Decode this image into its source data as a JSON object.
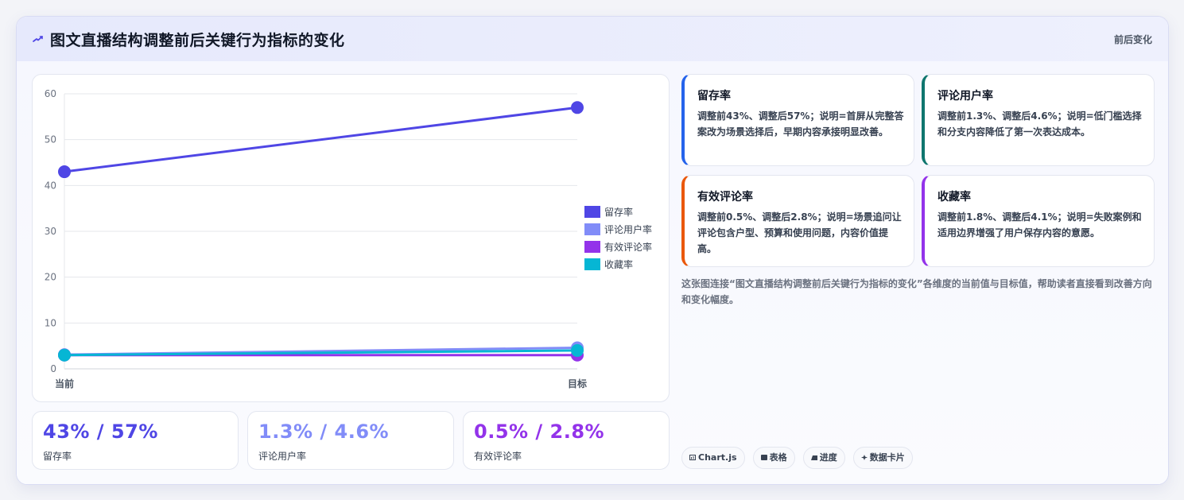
{
  "header": {
    "title": "图文直播结构调整前后关键行为指标的变化",
    "tag": "前后变化"
  },
  "colors": {
    "retention": "#4f46e5",
    "comment_users": "#818cf8",
    "valid_comment": "#9333ea",
    "favorite": "#06b6d4",
    "accent_blue": "#2563eb",
    "accent_teal": "#0f766e",
    "accent_orange": "#ea580c",
    "accent_purple": "#9333ea"
  },
  "chart_data": {
    "type": "line",
    "categories": [
      "当前",
      "目标"
    ],
    "series": [
      {
        "name": "留存率",
        "values": [
          43,
          57
        ],
        "color": "#4f46e5"
      },
      {
        "name": "评论用户率",
        "values": [
          3.1,
          4.6
        ],
        "color": "#818cf8"
      },
      {
        "name": "有效评论率",
        "values": [
          3.0,
          3.0
        ],
        "color": "#9333ea"
      },
      {
        "name": "收藏率",
        "values": [
          3.0,
          4.0
        ],
        "color": "#06b6d4"
      }
    ],
    "ylim": [
      0,
      60
    ],
    "yticks": [
      0,
      10,
      20,
      30,
      40,
      50,
      60
    ],
    "grid": true,
    "legend": "right"
  },
  "stats": [
    {
      "value": "43% / 57%",
      "label": "留存率",
      "color": "#4f46e5"
    },
    {
      "value": "1.3% / 4.6%",
      "label": "评论用户率",
      "color": "#818cf8"
    },
    {
      "value": "0.5% / 2.8%",
      "label": "有效评论率",
      "color": "#9333ea"
    }
  ],
  "metrics": [
    {
      "title": "留存率",
      "desc": "调整前43%、调整后57%；说明=首屏从完整答案改为场景选择后，早期内容承接明显改善。"
    },
    {
      "title": "评论用户率",
      "desc": "调整前1.3%、调整后4.6%；说明=低门槛选择和分支内容降低了第一次表达成本。"
    },
    {
      "title": "有效评论率",
      "desc": "调整前0.5%、调整后2.8%；说明=场景追问让评论包含户型、预算和使用问题，内容价值提高。"
    },
    {
      "title": "收藏率",
      "desc": "调整前1.8%、调整后4.1%；说明=失败案例和适用边界增强了用户保存内容的意愿。"
    }
  ],
  "summary": "这张图连接“图文直播结构调整前后关键行为指标的变化”各维度的当前值与目标值，帮助读者直接看到改善方向和变化幅度。",
  "chips": [
    {
      "label": "Chart.js",
      "icon": "chart-icon"
    },
    {
      "label": "表格",
      "icon": "table-icon"
    },
    {
      "label": "进度",
      "icon": "progress-icon"
    },
    {
      "label": "数据卡片",
      "icon": "sparkle-icon"
    }
  ]
}
